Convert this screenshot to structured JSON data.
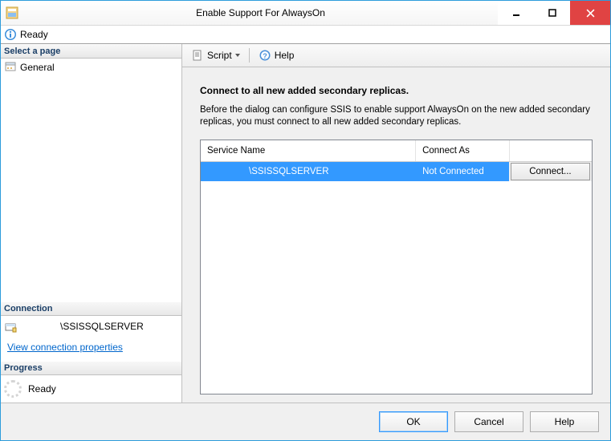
{
  "window": {
    "title": "Enable Support For AlwaysOn"
  },
  "status": {
    "text": "Ready"
  },
  "sidebar": {
    "select_page_header": "Select a page",
    "pages": [
      {
        "label": "General"
      }
    ],
    "connection_header": "Connection",
    "connection_server": "\\SSISSQLSERVER",
    "view_conn_props": "View connection properties",
    "progress_header": "Progress",
    "progress_text": "Ready"
  },
  "toolbar": {
    "script_label": "Script",
    "help_label": "Help"
  },
  "content": {
    "heading": "Connect to all new added secondary replicas.",
    "description": "Before the dialog can configure SSIS to enable support AlwaysOn on the new added secondary replicas, you must connect to all new added secondary replicas.",
    "columns": {
      "service_name": "Service Name",
      "connect_as": "Connect As",
      "action": ""
    },
    "rows": [
      {
        "service_name": "\\SSISSQLSERVER",
        "connect_as": "Not Connected",
        "action_label": "Connect..."
      }
    ]
  },
  "footer": {
    "ok": "OK",
    "cancel": "Cancel",
    "help": "Help"
  }
}
